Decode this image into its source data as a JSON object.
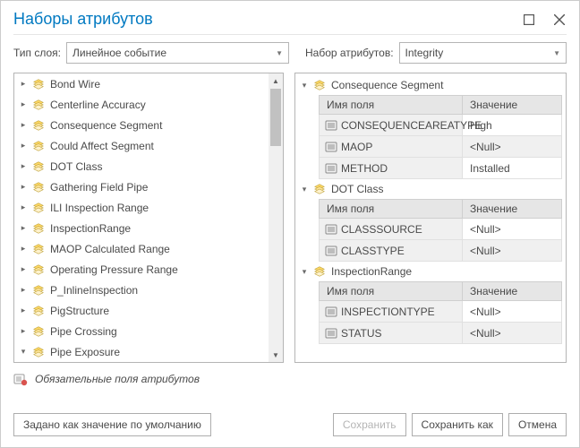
{
  "window": {
    "title": "Наборы атрибутов"
  },
  "top": {
    "layer_type_label": "Тип слоя:",
    "layer_type_value": "Линейное событие",
    "attr_set_label": "Набор атрибутов:",
    "attr_set_value": "Integrity"
  },
  "layers": [
    "Bond Wire",
    "Centerline Accuracy",
    "Consequence Segment",
    "Could Affect Segment",
    "DOT Class",
    "Gathering Field Pipe",
    "ILI Inspection Range",
    "InspectionRange",
    "MAOP Calculated Range",
    "Operating Pressure Range",
    "P_InlineInspection",
    "PigStructure",
    "Pipe Crossing",
    "Pipe Exposure"
  ],
  "headers": {
    "field_name": "Имя поля",
    "value": "Значение"
  },
  "groups": [
    {
      "name": "Consequence Segment",
      "rows": [
        {
          "field": "CONSEQUENCEAREATYPE",
          "value": "High"
        },
        {
          "field": "MAOP",
          "value": "<Null>"
        },
        {
          "field": "METHOD",
          "value": "Installed"
        }
      ]
    },
    {
      "name": "DOT Class",
      "rows": [
        {
          "field": "CLASSSOURCE",
          "value": "<Null>"
        },
        {
          "field": "CLASSTYPE",
          "value": "<Null>"
        }
      ]
    },
    {
      "name": "InspectionRange",
      "rows": [
        {
          "field": "INSPECTIONTYPE",
          "value": "<Null>"
        },
        {
          "field": "STATUS",
          "value": "<Null>"
        }
      ]
    }
  ],
  "footer": {
    "required_note": "Обязательные поля атрибутов",
    "set_default": "Задано как значение по умолчанию",
    "save": "Сохранить",
    "save_as": "Сохранить как",
    "cancel": "Отмена"
  }
}
